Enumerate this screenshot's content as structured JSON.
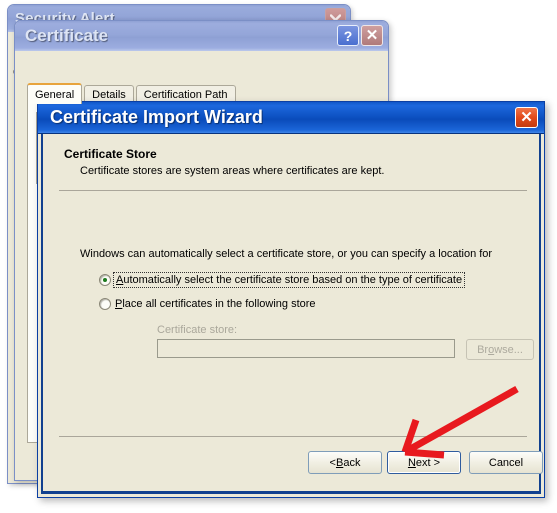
{
  "security_alert": {
    "title": "Security Alert",
    "close_icon": "close-icon",
    "occluded_text": "C"
  },
  "certificate_dialog": {
    "title": "Certificate",
    "help_icon": "?",
    "close_icon": "✕",
    "tabs": [
      {
        "label": "General",
        "active": true
      },
      {
        "label": "Details",
        "active": false
      },
      {
        "label": "Certification Path",
        "active": false
      }
    ]
  },
  "wizard": {
    "title": "Certificate Import Wizard",
    "close_icon": "✕",
    "heading": "Certificate Store",
    "subheading": "Certificate stores are system areas where certificates are kept.",
    "intro_text": "Windows can automatically select a certificate store, or you can specify a location for",
    "options": [
      {
        "id": "automatic",
        "label_pre": "A",
        "label_accel": "A",
        "label_rest": "utomatically select the certificate store based on the type of certificate",
        "full_label": "Automatically select the certificate store based on the type of certificate",
        "checked": true,
        "focused": true
      },
      {
        "id": "place-all",
        "label_accel": "P",
        "label_rest": "lace all certificates in the following store",
        "full_label": "Place all certificates in the following store",
        "checked": false,
        "focused": false
      }
    ],
    "store_field": {
      "label": "Certificate store:",
      "value": "",
      "placeholder": "",
      "disabled": true
    },
    "browse_button": {
      "accel_pre": "Br",
      "accel": "o",
      "accel_post": "wse...",
      "label": "Browse...",
      "disabled": true
    },
    "footer_buttons": [
      {
        "id": "back",
        "pre": "< ",
        "accel": "B",
        "post": "ack",
        "label": "< Back",
        "default": false
      },
      {
        "id": "next",
        "pre": "",
        "accel": "N",
        "post": "ext >",
        "label": "Next >",
        "default": true
      },
      {
        "id": "cancel",
        "pre": "",
        "accel": "",
        "post": "Cancel",
        "label": "Cancel",
        "default": false
      }
    ]
  },
  "annotation": {
    "type": "red-arrow",
    "color": "#e8191e",
    "points_to": "next-button"
  }
}
